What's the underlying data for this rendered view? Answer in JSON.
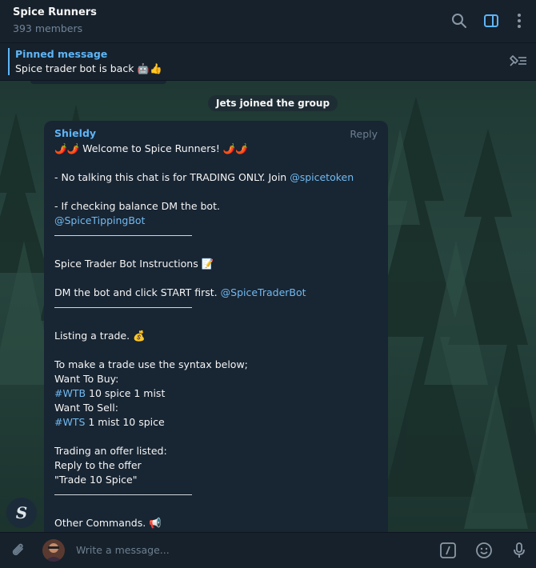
{
  "header": {
    "title": "Spice Runners",
    "subtitle": "393 members"
  },
  "pinned": {
    "label": "Pinned message",
    "text": "Spice trader bot is back 🤖👍"
  },
  "service_message": "Jets joined the group",
  "message": {
    "sender": "Shieldy",
    "reply_label": "Reply",
    "lines": [
      {
        "text": "🌶️🌶️ Welcome to Spice Runners! 🌶️🌶️"
      },
      {
        "text": ""
      },
      {
        "text": "- No talking this chat is for TRADING ONLY. Join ",
        "link": "@spicetoken"
      },
      {
        "text": ""
      },
      {
        "text": "- If checking balance DM the bot."
      },
      {
        "text": "",
        "link": "@SpiceTippingBot"
      },
      {
        "divider": true
      },
      {
        "text": ""
      },
      {
        "text": "Spice Trader Bot Instructions 📝"
      },
      {
        "text": ""
      },
      {
        "text": "DM the bot and click START first. ",
        "link": "@SpiceTraderBot"
      },
      {
        "divider": true
      },
      {
        "text": ""
      },
      {
        "text": "Listing a trade. 💰"
      },
      {
        "text": ""
      },
      {
        "text": "To make a trade use the syntax below;"
      },
      {
        "text": "Want To Buy:"
      },
      {
        "text": " 10 spice 1 mist",
        "link_first": "#WTB"
      },
      {
        "text": "Want To Sell:"
      },
      {
        "text": " 1 mist 10 spice",
        "link_first": "#WTS"
      },
      {
        "text": ""
      },
      {
        "text": "Trading an offer listed:"
      },
      {
        "text": "Reply to the offer"
      },
      {
        "text": "\"Trade 10 Spice\""
      },
      {
        "divider": true
      },
      {
        "text": ""
      },
      {
        "text": "Other Commands. 📢"
      }
    ]
  },
  "sender_avatar_letter": "S",
  "composer": {
    "placeholder": "Write a message..."
  },
  "icons": [
    "search-icon",
    "sidebar-toggle-icon",
    "more-vertical-icon",
    "pinned-list-icon",
    "attach-icon",
    "commands-icon",
    "emoji-icon",
    "microphone-icon"
  ],
  "colors": {
    "accent": "#5eb5f7",
    "bubble": "#182533",
    "header": "#17212b"
  }
}
